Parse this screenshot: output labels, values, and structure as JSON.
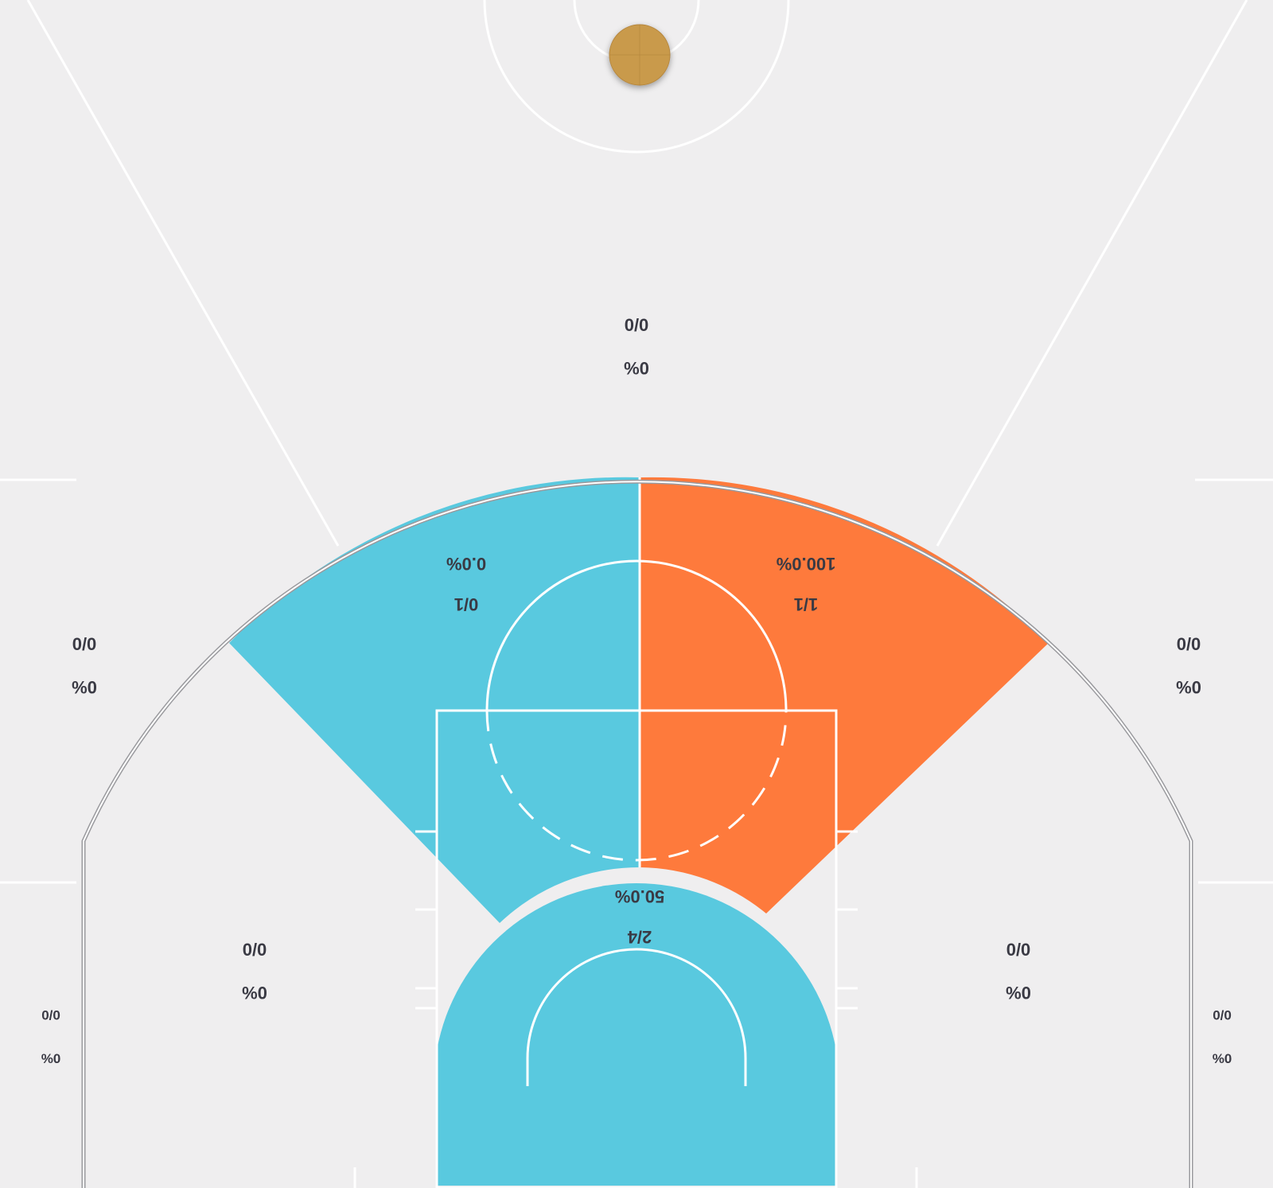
{
  "chart_data": {
    "type": "shot-zone-chart",
    "orientation": "rotated-180",
    "colors": {
      "court": "#efeeef",
      "lines": "#ffffff",
      "cold": "#59c9df",
      "hot": "#fe7a3c",
      "text": "#3a3a44",
      "ball": "#c99a4c"
    },
    "zones": [
      {
        "id": "paint",
        "made_attempts": "2/4",
        "percent": "50.0%",
        "fill": "cold"
      },
      {
        "id": "mid-left",
        "made_attempts": "0/1",
        "percent": "0.0%",
        "fill": "cold"
      },
      {
        "id": "mid-right",
        "made_attempts": "1/1",
        "percent": "100.0%",
        "fill": "hot"
      },
      {
        "id": "top-three",
        "made_attempts": "0/0",
        "percent": "0%",
        "fill": "none"
      },
      {
        "id": "wing-left",
        "made_attempts": "0/0",
        "percent": "0%",
        "fill": "none"
      },
      {
        "id": "wing-right",
        "made_attempts": "0/0",
        "percent": "0%",
        "fill": "none"
      },
      {
        "id": "baseline-mid-left",
        "made_attempts": "0/0",
        "percent": "0%",
        "fill": "none"
      },
      {
        "id": "baseline-mid-right",
        "made_attempts": "0/0",
        "percent": "0%",
        "fill": "none"
      },
      {
        "id": "corner-left",
        "made_attempts": "0/0",
        "percent": "0%",
        "fill": "none"
      },
      {
        "id": "corner-right",
        "made_attempts": "0/0",
        "percent": "0%",
        "fill": "none"
      }
    ]
  }
}
